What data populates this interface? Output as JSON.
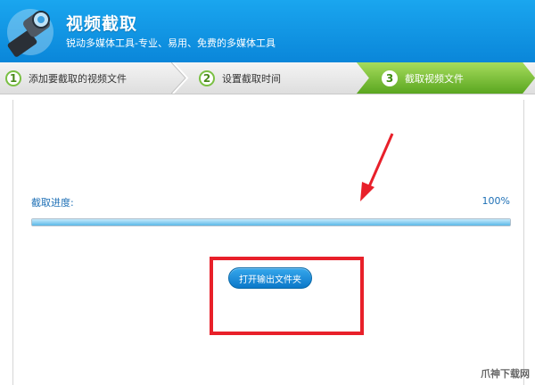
{
  "header": {
    "title": "视频截取",
    "subtitle": "锐动多媒体工具-专业、易用、免费的多媒体工具"
  },
  "steps": [
    {
      "number": "1",
      "label": "添加要截取的视频文件",
      "active": false
    },
    {
      "number": "2",
      "label": "设置截取时间",
      "active": false
    },
    {
      "number": "3",
      "label": "截取视频文件",
      "active": true
    }
  ],
  "progress": {
    "label": "截取进度:",
    "percent_text": "100%",
    "value": 1.0
  },
  "actions": {
    "open_output_folder": "打开输出文件夹"
  },
  "watermark": "爪神下载网",
  "colors": {
    "header_blue": "#0a86d9",
    "active_step_green": "#7ac043",
    "annotation_red": "#e8202a"
  }
}
